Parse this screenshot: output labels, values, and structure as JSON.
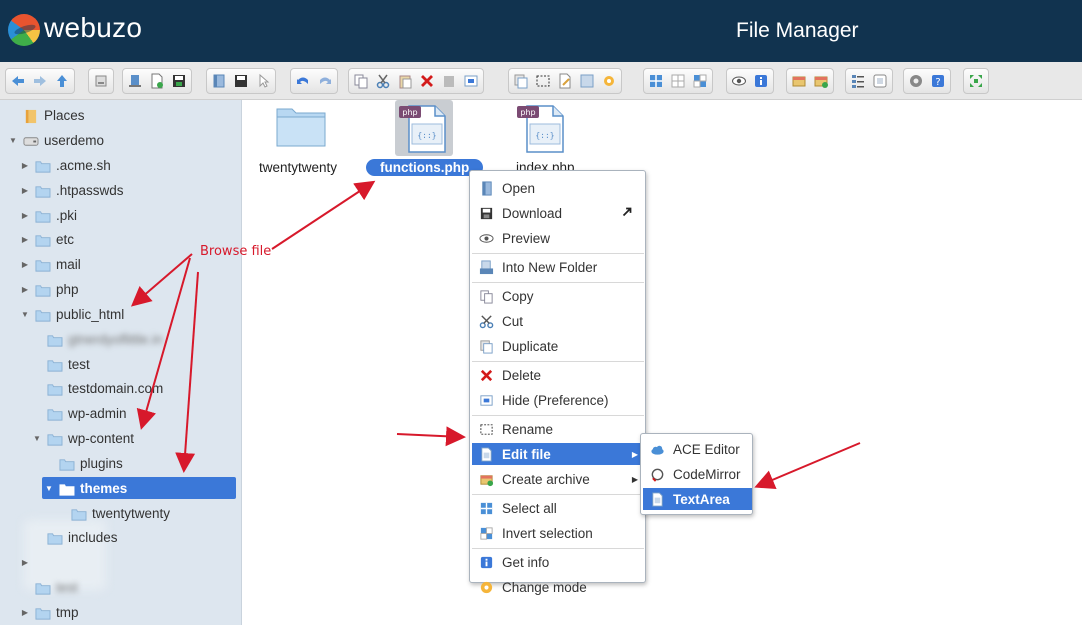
{
  "header": {
    "logo_text": "webuzo",
    "title": "File Manager"
  },
  "toolbar": {
    "groups": [
      [
        "arrow-left-icon",
        "arrow-right-icon",
        "arrow-up-icon"
      ],
      [
        "home-icon"
      ],
      [
        "network-drive-icon",
        "new-file-icon",
        "save-icon"
      ],
      [
        "open-icon",
        "save-as-icon",
        "pointer-icon"
      ],
      [
        "undo-icon",
        "redo-icon"
      ],
      [
        "copy-icon",
        "cut-icon",
        "paste-icon",
        "delete-icon",
        "empty-icon",
        "hide-icon"
      ],
      [
        "duplicate-icon",
        "rename-icon",
        "edit-icon",
        "resize-icon",
        "gear-small-icon"
      ],
      [
        "select-all-icon",
        "select-none-icon",
        "invert-selection-icon"
      ],
      [
        "preview-icon",
        "info-icon"
      ],
      [
        "extract-icon",
        "archive-icon"
      ],
      [
        "list-view-icon",
        "icon-view-icon"
      ],
      [
        "settings-icon",
        "help-icon"
      ],
      [
        "fullscreen-icon"
      ]
    ]
  },
  "sidebar": {
    "items": [
      {
        "label": "Places",
        "depth": 0,
        "arrow": "",
        "icon": "places-icon"
      },
      {
        "label": "userdemo",
        "depth": 0,
        "arrow": "open",
        "icon": "drive-icon"
      },
      {
        "label": ".acme.sh",
        "depth": 1,
        "arrow": "closed",
        "icon": "folder-icon"
      },
      {
        "label": ".htpasswds",
        "depth": 1,
        "arrow": "closed",
        "icon": "folder-icon"
      },
      {
        "label": ".pki",
        "depth": 1,
        "arrow": "closed",
        "icon": "folder-icon"
      },
      {
        "label": "etc",
        "depth": 1,
        "arrow": "closed",
        "icon": "folder-icon"
      },
      {
        "label": "mail",
        "depth": 1,
        "arrow": "closed",
        "icon": "folder-icon"
      },
      {
        "label": "php",
        "depth": 1,
        "arrow": "closed",
        "icon": "folder-icon"
      },
      {
        "label": "public_html",
        "depth": 1,
        "arrow": "open",
        "icon": "folder-icon"
      },
      {
        "label": "gtnerdyoflittle.in",
        "depth": 2,
        "arrow": "",
        "icon": "folder-icon",
        "blurred": true
      },
      {
        "label": "test",
        "depth": 2,
        "arrow": "",
        "icon": "folder-icon"
      },
      {
        "label": "testdomain.com",
        "depth": 2,
        "arrow": "",
        "icon": "folder-icon"
      },
      {
        "label": "wp-admin",
        "depth": 2,
        "arrow": "",
        "icon": "folder-icon"
      },
      {
        "label": "wp-content",
        "depth": 2,
        "arrow": "open",
        "icon": "folder-icon"
      },
      {
        "label": "plugins",
        "depth": 3,
        "arrow": "",
        "icon": "folder-icon"
      },
      {
        "label": "themes",
        "depth": 3,
        "arrow": "open",
        "icon": "folder-open-icon",
        "selected": true
      },
      {
        "label": "twentytwenty",
        "depth": 4,
        "arrow": "",
        "icon": "folder-icon"
      },
      {
        "label": "includes",
        "depth": 2,
        "arrow": "",
        "icon": "folder-icon"
      },
      {
        "label": "",
        "depth": 1,
        "arrow": "closed",
        "icon": ""
      },
      {
        "label": "test",
        "depth": 1,
        "arrow": "",
        "icon": "folder-icon",
        "blurred": true
      },
      {
        "label": "tmp",
        "depth": 1,
        "arrow": "closed",
        "icon": "folder-icon"
      }
    ]
  },
  "files": [
    {
      "name": "twentytwenty",
      "type": "folder"
    },
    {
      "name": "functions.php",
      "type": "php",
      "selected": true,
      "badge": "php"
    },
    {
      "name": "index.php",
      "type": "php",
      "badge": "php"
    }
  ],
  "context_menu": {
    "items": [
      {
        "label": "Open",
        "icon": "open-book-icon"
      },
      {
        "label": "Download",
        "icon": "download-icon",
        "extra": "external-arrow-icon"
      },
      {
        "label": "Preview",
        "icon": "eye-icon"
      },
      {
        "sep": true
      },
      {
        "label": "Into New Folder",
        "icon": "into-folder-icon"
      },
      {
        "sep": true
      },
      {
        "label": "Copy",
        "icon": "copy-icon"
      },
      {
        "label": "Cut",
        "icon": "scissors-icon"
      },
      {
        "label": "Duplicate",
        "icon": "duplicate-icon"
      },
      {
        "sep": true
      },
      {
        "label": "Delete",
        "icon": "delete-x-icon"
      },
      {
        "label": "Hide (Preference)",
        "icon": "hide-icon"
      },
      {
        "sep": true
      },
      {
        "label": "Rename",
        "icon": "rename-icon"
      },
      {
        "label": "Edit file",
        "icon": "edit-file-icon",
        "submenu": true,
        "active": true
      },
      {
        "label": "Create archive",
        "icon": "archive-icon",
        "submenu": true
      },
      {
        "sep": true
      },
      {
        "label": "Select all",
        "icon": "select-all-icon"
      },
      {
        "label": "Invert selection",
        "icon": "invert-icon"
      },
      {
        "sep": true
      },
      {
        "label": "Get info",
        "icon": "info-icon"
      },
      {
        "label": "Change mode",
        "icon": "gear-icon"
      }
    ]
  },
  "sub_menu": {
    "items": [
      {
        "label": "ACE Editor",
        "icon": "cloud-icon"
      },
      {
        "label": "CodeMirror",
        "icon": "codemirror-icon"
      },
      {
        "label": "TextArea",
        "icon": "textarea-icon",
        "active": true
      }
    ]
  },
  "annotations": {
    "browse_file": "Browse file"
  },
  "colors": {
    "header_bg": "#11334f",
    "selection": "#3b78d8",
    "sidebar_bg": "#dde6ef",
    "annotation": "#d7192b"
  }
}
